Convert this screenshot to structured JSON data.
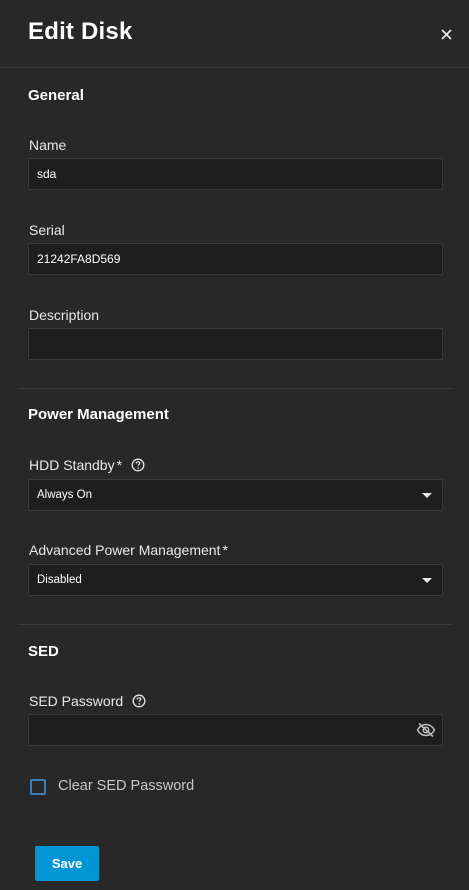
{
  "dialog": {
    "title": "Edit Disk",
    "close_icon": "close-icon"
  },
  "general": {
    "section_title": "General",
    "name": {
      "label": "Name",
      "value": "sda"
    },
    "serial": {
      "label": "Serial",
      "value": "21242FA8D569"
    },
    "description": {
      "label": "Description",
      "value": ""
    }
  },
  "power": {
    "section_title": "Power Management",
    "hdd_standby": {
      "label": "HDD Standby",
      "required_mark": "*",
      "value": "Always On",
      "help_icon": "help-circle-icon"
    },
    "apm": {
      "label": "Advanced Power Management",
      "required_mark": "*",
      "value": "Disabled"
    }
  },
  "sed": {
    "section_title": "SED",
    "password": {
      "label": "SED Password",
      "value": "",
      "help_icon": "help-circle-icon",
      "toggle_icon": "eye-off-icon"
    },
    "clear_checkbox": {
      "label": "Clear SED Password",
      "checked": false
    }
  },
  "actions": {
    "save_label": "Save"
  },
  "colors": {
    "background": "#282828",
    "input_background": "#1e1e1e",
    "primary": "#0095d5",
    "checkbox_border": "#3c7fb5"
  }
}
